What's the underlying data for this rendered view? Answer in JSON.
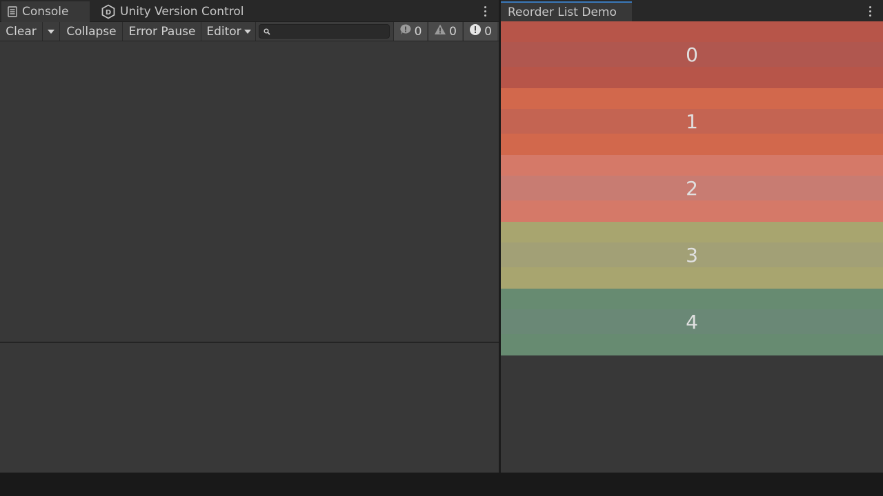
{
  "console": {
    "tabs": [
      {
        "label": "Console",
        "icon": "console-list-icon"
      },
      {
        "label": "Unity Version Control",
        "icon": "unity-vcs-icon"
      }
    ],
    "toolbar": {
      "clear_label": "Clear",
      "collapse_label": "Collapse",
      "error_pause_label": "Error Pause",
      "editor_label": "Editor",
      "search_placeholder": "",
      "log_count": "0",
      "warning_count": "0",
      "error_count": "0"
    }
  },
  "reorder_demo": {
    "tab_label": "Reorder List Demo",
    "items": [
      {
        "label": "0",
        "color": "#b75549",
        "band_color": "#b0574f"
      },
      {
        "label": "1",
        "color": "#d2684c",
        "band_color": "#c46452"
      },
      {
        "label": "2",
        "color": "#d57968",
        "band_color": "#c87c72"
      },
      {
        "label": "3",
        "color": "#a8a56f",
        "band_color": "#a2a076"
      },
      {
        "label": "4",
        "color": "#678b71",
        "band_color": "#6a8876"
      }
    ]
  },
  "colors": {
    "panel_bg": "#383838",
    "tab_bar_bg": "#282828",
    "active_tab_accent": "#3a79bb",
    "text": "#c4c4c4"
  }
}
